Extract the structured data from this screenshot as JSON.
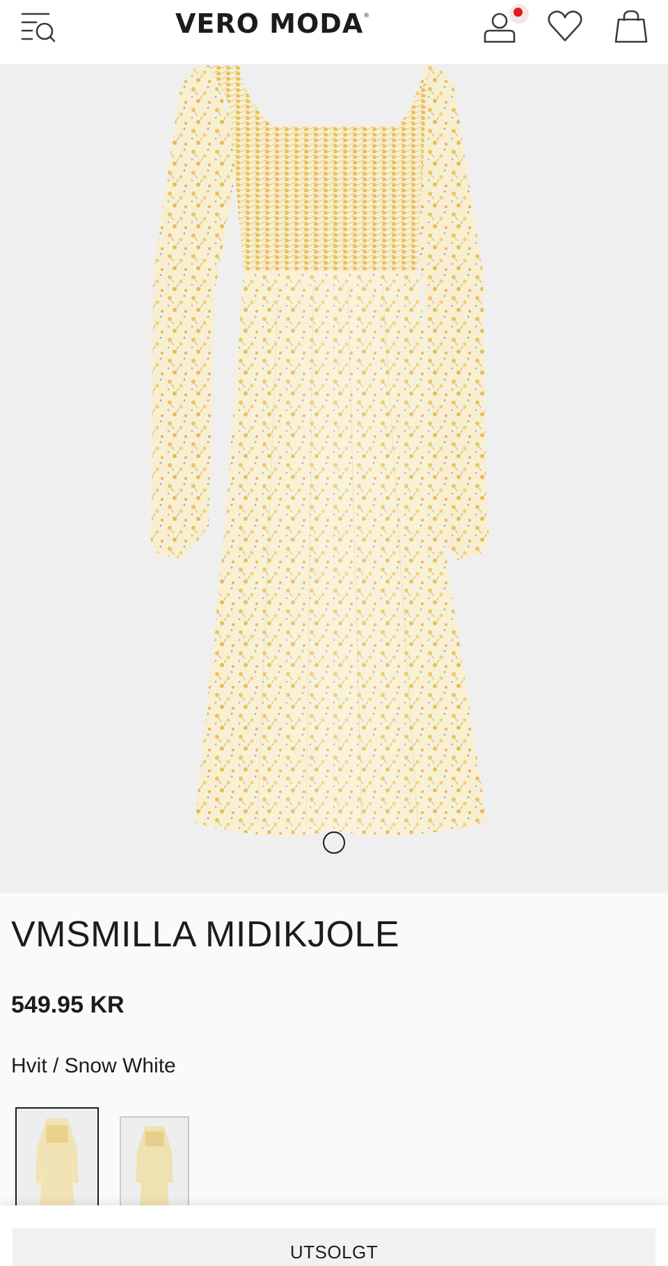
{
  "header": {
    "brand": "VERO MODA",
    "brand_mark": "®",
    "icons": [
      "menu-search-icon",
      "account-icon",
      "heart-icon",
      "shopping-bag-icon"
    ],
    "notification_dot_color": "#e01b1b"
  },
  "product": {
    "title": "VMSMILLA MIDIKJOLE",
    "price": "549.95 KR",
    "color": "Hvit / Snow White"
  },
  "swatches": [
    {
      "selected": true
    },
    {
      "selected": false
    }
  ],
  "actions": {
    "soldout_label": "UTSOLGT"
  },
  "colors": {
    "header_bg": "#ffffff",
    "gallery_bg": "#f0eff0",
    "text": "#1c1c1c",
    "button_bg": "#f1f1f2"
  }
}
